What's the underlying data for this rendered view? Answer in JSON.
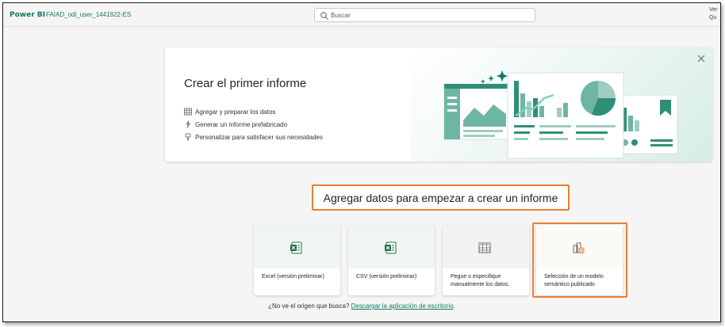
{
  "topbar": {
    "brand": "Power BI",
    "workspace": "FAIAD_odl_user_1441922-ES",
    "search_placeholder": "Buscar",
    "user_line1": "Ver",
    "user_line2": "Qu"
  },
  "hero": {
    "title": "Crear el primer informe",
    "items": [
      {
        "label": "Agregar y preparar los datos",
        "icon": "table-icon"
      },
      {
        "label": "Generar un informe prefabricado",
        "icon": "sparkle-icon"
      },
      {
        "label": "Personalizar para satisfacer sus necesidades",
        "icon": "brush-icon"
      }
    ]
  },
  "section": {
    "title": "Agregar datos para empezar a crear un informe"
  },
  "cards": [
    {
      "label": "Excel (versión preliminar)",
      "icon": "excel-icon"
    },
    {
      "label": "CSV (versión preliminar)",
      "icon": "csv-icon"
    },
    {
      "label": "Pegue o especifique manualmente los datos.",
      "icon": "grid-icon"
    },
    {
      "label": "Selección de un modelo semántico publicado",
      "icon": "semantic-model-icon"
    }
  ],
  "footer": {
    "question": "¿No ve el origen que busca?",
    "link": "Descargar la aplicación de escritorio",
    "suffix": "."
  },
  "colors": {
    "accent": "#117865",
    "highlight": "#ed7d31",
    "illustration": "#2f8f76"
  }
}
